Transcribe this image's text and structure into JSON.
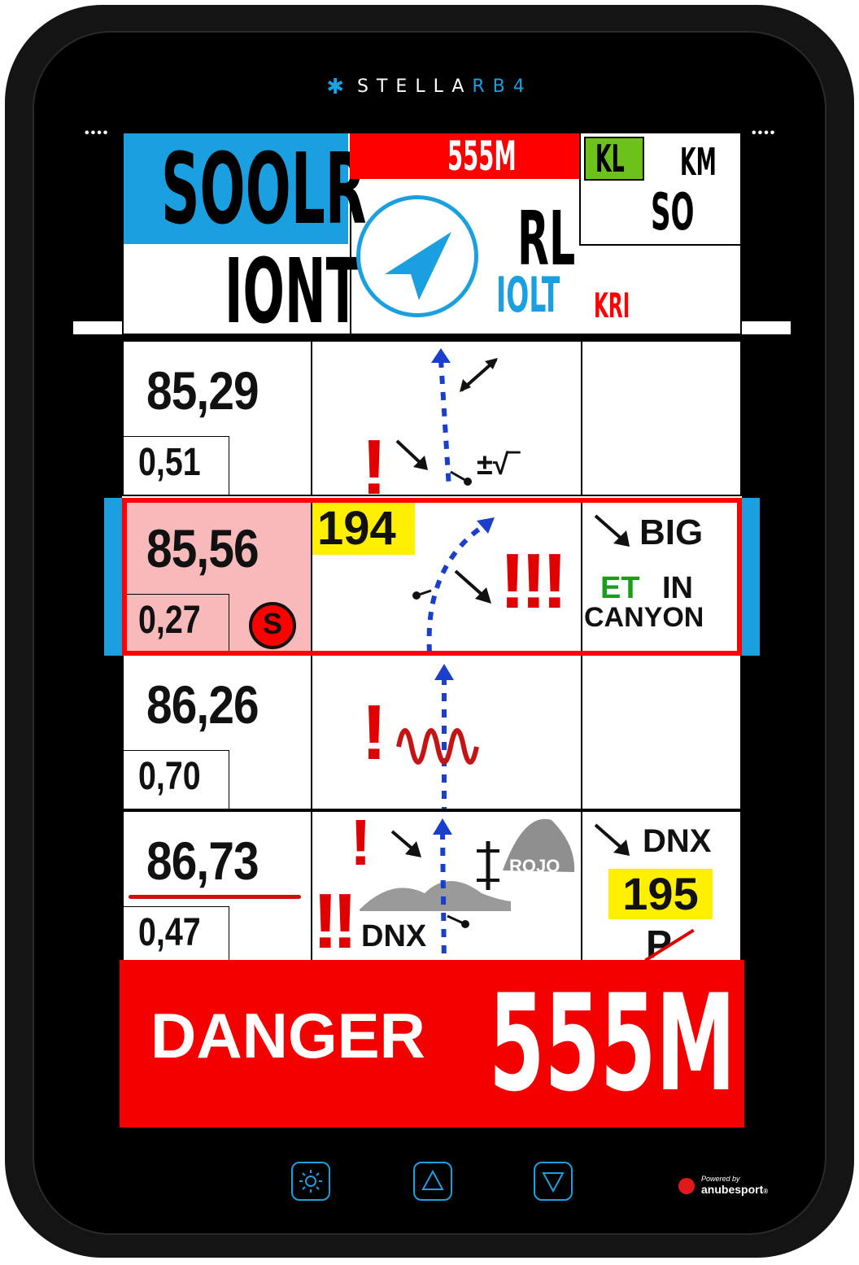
{
  "device": {
    "brand_prefix": "STELLA",
    "brand_suffix": "RB4",
    "dots_left": "••••",
    "dots_right": "••••",
    "powered_by_label": "Powered by",
    "powered_by_brand": "anubesport",
    "powered_by_mark": "®",
    "buttons": [
      "brightness-icon",
      "up-triangle-icon",
      "down-triangle-icon"
    ]
  },
  "header": {
    "speed": "SOOLR",
    "time": "IONT",
    "alert_distance": "555M",
    "heading": "RL",
    "heading_sub_blue": "IOLT",
    "heading_sub_red": "KRI",
    "kl_label": "KL",
    "km_label": "KM",
    "km_value": "SO"
  },
  "roadbook": [
    {
      "distance": "85,29",
      "partial": "0,51",
      "notes": [],
      "active": false
    },
    {
      "distance": "85,56",
      "partial": "0,27",
      "badge": "S",
      "waypoint": "194",
      "notes": [
        "BIG",
        "ET",
        "IN",
        "CANYON"
      ],
      "active": true
    },
    {
      "distance": "86,26",
      "partial": "0,70",
      "notes": [],
      "active": false
    },
    {
      "distance": "86,73",
      "partial": "0,47",
      "label_rojo": "ROJO",
      "label_dnx": "DNX",
      "notes": [
        "DNX",
        "195",
        "P"
      ],
      "active": false
    }
  ],
  "tulip_glyphs": {
    "sqrt": "±√‾",
    "danger_single": "!",
    "danger_triple": "!!!",
    "danger_double": "!!"
  },
  "banner": {
    "label": "DANGER",
    "distance": "555M"
  },
  "colors": {
    "blue": "#1aa0e0",
    "red": "#ff0000",
    "green": "#6cc21a",
    "yellow": "#ffef00",
    "pink": "#f7b9b9"
  }
}
